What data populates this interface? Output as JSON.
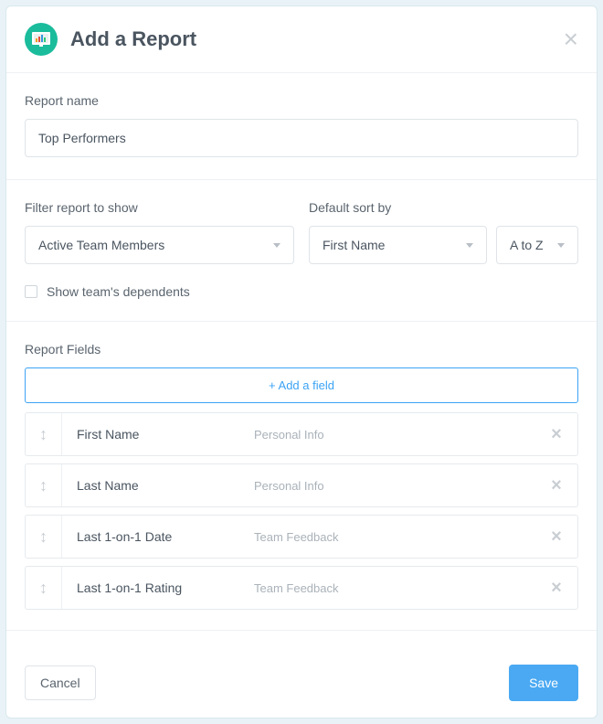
{
  "header": {
    "title": "Add a Report"
  },
  "reportName": {
    "label": "Report name",
    "value": "Top Performers"
  },
  "filter": {
    "label": "Filter report to show",
    "value": "Active Team Members"
  },
  "sort": {
    "label": "Default sort by",
    "field": "First Name",
    "direction": "A to Z"
  },
  "dependents": {
    "label": "Show team's dependents",
    "checked": false
  },
  "fields": {
    "label": "Report Fields",
    "addLabel": "+ Add a field",
    "items": [
      {
        "name": "First Name",
        "category": "Personal Info"
      },
      {
        "name": "Last Name",
        "category": "Personal Info"
      },
      {
        "name": "Last 1-on-1 Date",
        "category": "Team Feedback"
      },
      {
        "name": "Last 1-on-1 Rating",
        "category": "Team Feedback"
      }
    ]
  },
  "footer": {
    "cancel": "Cancel",
    "save": "Save"
  }
}
